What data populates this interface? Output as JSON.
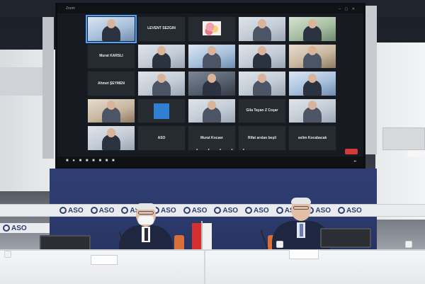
{
  "screen": {
    "title": "Zoom",
    "participants": [
      {
        "name": "",
        "style": "video blue",
        "active": true
      },
      {
        "name": "LEVENT SEZGIN",
        "style": "blank"
      },
      {
        "name": "",
        "style": "flowers"
      },
      {
        "name": "",
        "style": "video"
      },
      {
        "name": "",
        "style": "video green"
      },
      {
        "name": "Murat KARSLI",
        "style": "blank"
      },
      {
        "name": "",
        "style": "video"
      },
      {
        "name": "",
        "style": "video blue"
      },
      {
        "name": "",
        "style": "video"
      },
      {
        "name": "",
        "style": "video warm"
      },
      {
        "name": "Ahmet ŞEYMEN",
        "style": "blank"
      },
      {
        "name": "",
        "style": "video"
      },
      {
        "name": "",
        "style": "video dark"
      },
      {
        "name": "",
        "style": "video"
      },
      {
        "name": "",
        "style": "video blue"
      },
      {
        "name": "",
        "style": "video warm"
      },
      {
        "name": "",
        "style": "bluesquare"
      },
      {
        "name": "",
        "style": "video"
      },
      {
        "name": "Gila Tayan Z Coşar",
        "style": "blank"
      },
      {
        "name": "",
        "style": "video"
      },
      {
        "name": "",
        "style": "video"
      },
      {
        "name": "ASO",
        "style": "blank"
      },
      {
        "name": "Murat Kocaer",
        "style": "blank"
      },
      {
        "name": "Rifat arslan beşli",
        "style": "blank"
      },
      {
        "name": "selim Kocabacak",
        "style": "blank"
      }
    ]
  },
  "backdrop": {
    "logo_text": "ASO",
    "logo_count": 10
  },
  "flag": {
    "right_text": "ASO"
  }
}
